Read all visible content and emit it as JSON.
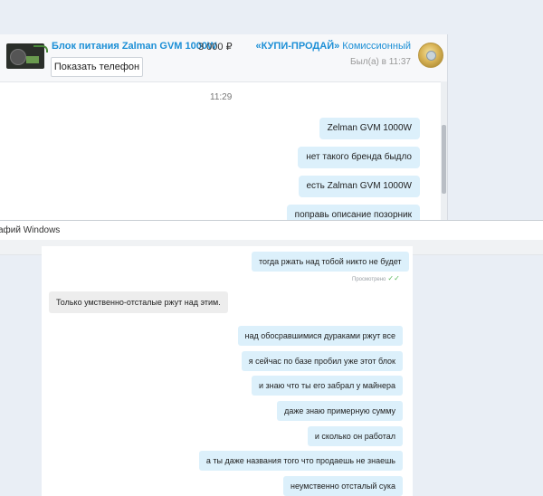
{
  "listing": {
    "title": "Блок питания Zalman GVM 1000W",
    "price": "3 000 ₽",
    "show_phone_label": "Показать телефон"
  },
  "seller": {
    "name": "«КУПИ-ПРОДАЙ»",
    "type": "Комиссионный",
    "last_seen": "Был(а) в 11:37"
  },
  "chat1": {
    "time": "11:29",
    "messages": [
      "Zelman GVM 1000W",
      "нет такого бренда быдло",
      "есть Zalman GVM 1000W",
      "поправь описание позорник"
    ]
  },
  "viewer": {
    "title": "афий Windows"
  },
  "chat2": {
    "top_message": "тогда ржать над тобой никто не будет",
    "read_status": "Просмотрено",
    "incoming": "Только умственно-отсталые   ржут над этим.",
    "outgoing": [
      "над обосравшимися дураками ржут все",
      "я сейчас по базе пробил уже этот блок",
      "и знаю что ты его забрал у майнера",
      "даже знаю примерную сумму",
      "и сколько он работал",
      "а ты даже названия того что продаешь не знаешь",
      "неумственно отсталый сука"
    ]
  },
  "colors": {
    "link": "#1c8fd6",
    "outgoing_bubble": "#dcf0fb",
    "incoming_bubble": "#ededed",
    "read_ticks": "#5cb85c"
  }
}
